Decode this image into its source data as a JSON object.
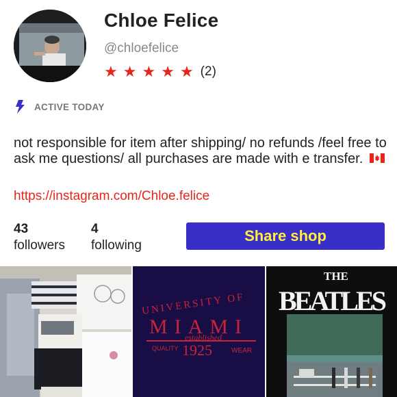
{
  "profile": {
    "name": "Chloe Felice",
    "handle": "@chloefelice",
    "rating_count": "(2)",
    "stars": 5,
    "star_glyph": "★",
    "active_status": "ACTIVE TODAY",
    "bio": "not responsible for item after shipping/ no refunds /feel free to ask me questions/ all purchases are made with e transfer.",
    "bio_emoji": "canada-flag-icon",
    "link": "https://instagram.com/Chloe.felice"
  },
  "stats": {
    "followers_count": "43",
    "followers_label": "followers",
    "following_count": "4",
    "following_label": "following"
  },
  "share_button": {
    "label": "Share shop"
  },
  "listings": [
    {
      "name": "listing-tile-1",
      "subject": "folded-clothes-photo"
    },
    {
      "name": "listing-tile-2",
      "subject": "university-of-miami-shirt-photo",
      "text": [
        "UNIVERSITY OF",
        "MIAMI",
        "QUALITY",
        "established",
        "1925",
        "WEAR"
      ]
    },
    {
      "name": "listing-tile-3",
      "subject": "beatles-shirt-photo",
      "text": [
        "THE",
        "BEATLES"
      ]
    }
  ],
  "colors": {
    "accent_red": "#e8251b",
    "button_bg": "#3a2ec8",
    "button_text": "#fff13b",
    "bolt": "#3a2ec8"
  }
}
